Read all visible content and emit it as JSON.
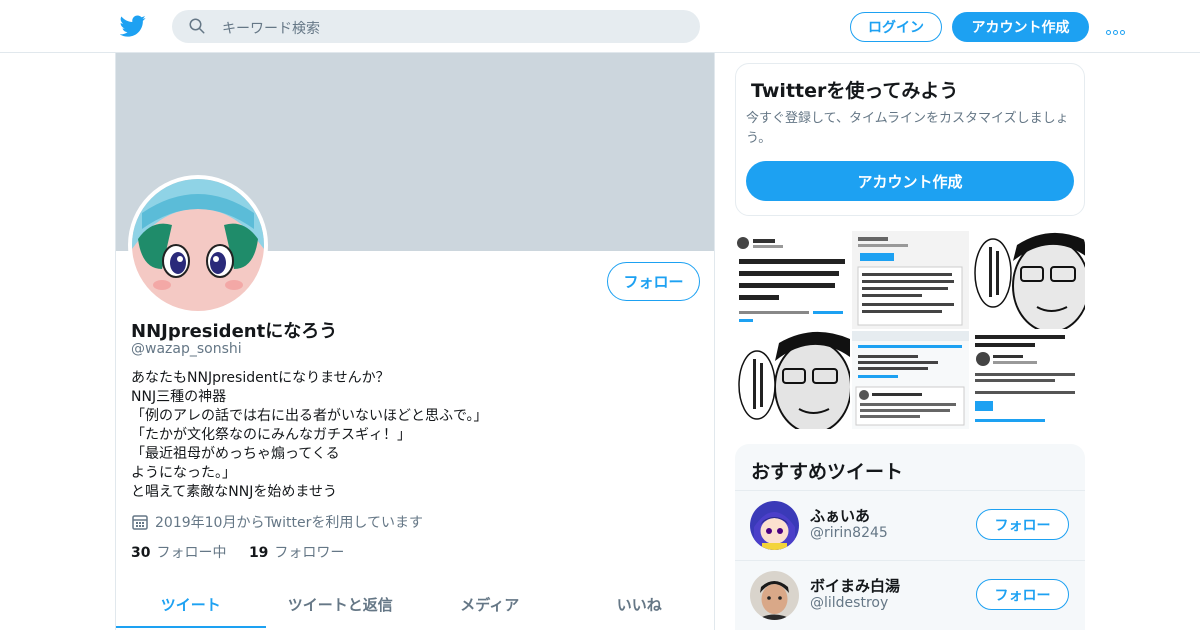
{
  "header": {
    "search_placeholder": "キーワード検索",
    "login_label": "ログイン",
    "signup_label": "アカウント作成",
    "brand_color": "#1da1f2"
  },
  "profile": {
    "follow_label": "フォロー",
    "display_name": "NNJpresidentになろう",
    "handle": "@wazap_sonshi",
    "bio_lines": [
      "あなたもNNJpresidentになりませんか？",
      "NNJ三種の神器",
      "「例のアレの話では右に出る者がいないほどと思ふで。」",
      "「たかが文化祭なのにみんなガチスギィ！」",
      "「最近祖母がめっちゃ煽ってくる",
      "ようになった。」",
      "と唱えて素敵なNNJを始めませう"
    ],
    "joined": "2019年10月からTwitterを利用しています",
    "following_count": "30",
    "following_label": "フォロー中",
    "followers_count": "19",
    "followers_label": "フォロワー",
    "banner_color": "#ccd6dd"
  },
  "tabs": [
    "ツイート",
    "ツイートと返信",
    "メディア",
    "いいね"
  ],
  "signup_card": {
    "title": "Twitterを使ってみよう",
    "description": "今すぐ登録して、タイムラインをカスタマイズしましょう。",
    "button_label": "アカウント作成"
  },
  "recommended": {
    "title": "おすすめツイート",
    "follow_label": "フォロー",
    "items": [
      {
        "name": "ふぁいあ",
        "handle": "@ririn8245"
      },
      {
        "name": "ボイまみ白湯",
        "handle": "@lildestroy"
      }
    ]
  }
}
